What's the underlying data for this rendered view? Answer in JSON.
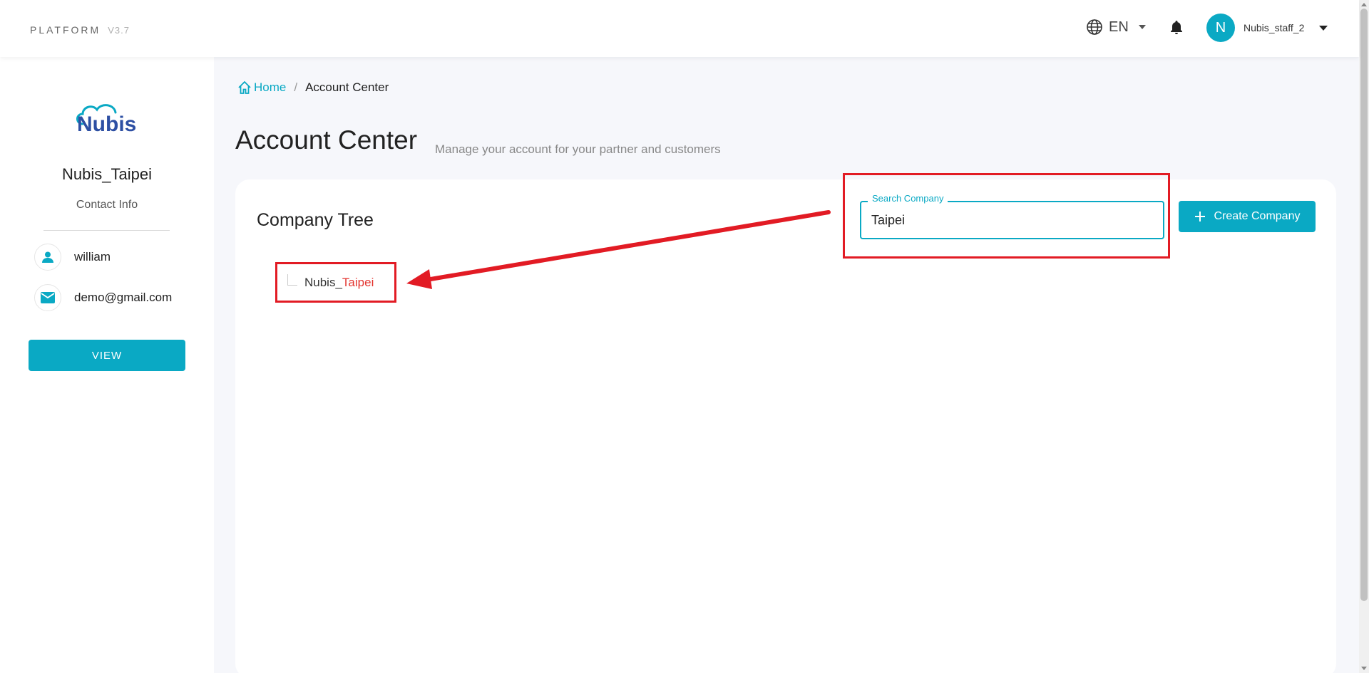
{
  "header": {
    "brand": "PLATFORM",
    "version": "V3.7",
    "language": "EN",
    "avatar_initial": "N",
    "username": "Nubis_staff_2"
  },
  "sidebar": {
    "logo_text": "Nubis",
    "company_name": "Nubis_Taipei",
    "contact_info_label": "Contact Info",
    "contact_name": "william",
    "contact_email": "demo@gmail.com",
    "view_button": "VIEW"
  },
  "breadcrumb": {
    "home": "Home",
    "separator": "/",
    "current": "Account Center"
  },
  "page": {
    "title": "Account Center",
    "subtitle": "Manage your account for your partner and customers"
  },
  "company_tree": {
    "title": "Company Tree",
    "node_prefix": "Nubis_",
    "node_match": "Taipei"
  },
  "search": {
    "label": "Search Company",
    "value": "Taipei"
  },
  "create_button": "Create Company",
  "colors": {
    "accent": "#0aa9c4",
    "highlight": "#e3342f",
    "annotation": "#e21b24"
  }
}
